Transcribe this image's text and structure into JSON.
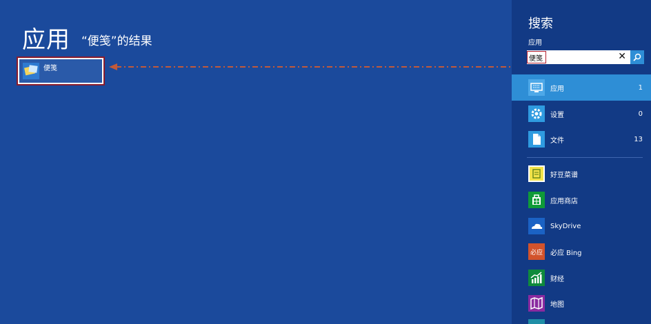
{
  "main": {
    "title": "应用",
    "result_caption": "“便笺”的结果",
    "result": {
      "label": "便笺"
    }
  },
  "search_panel": {
    "title": "搜索",
    "scope_label": "应用",
    "input": {
      "value": "便笺",
      "placeholder": ""
    },
    "clear_icon": "✕",
    "categories": [
      {
        "label": "应用",
        "count": "1",
        "icon": "keyboard-icon"
      },
      {
        "label": "设置",
        "count": "0",
        "icon": "gear-icon"
      },
      {
        "label": "文件",
        "count": "13",
        "icon": "document-icon"
      }
    ],
    "apps": [
      {
        "label": "好豆菜谱",
        "icon": "recipe-icon",
        "color": "#f3e34a"
      },
      {
        "label": "应用商店",
        "icon": "store-icon",
        "color": "#0f9b38"
      },
      {
        "label": "SkyDrive",
        "icon": "cloud-icon",
        "color": "#1b62c4"
      },
      {
        "label": "必应 Bing",
        "icon": "bing-icon",
        "color": "#d2532c",
        "icon_text": "必应"
      },
      {
        "label": "财经",
        "icon": "finance-icon",
        "color": "#0f8a3c"
      },
      {
        "label": "地图",
        "icon": "map-icon",
        "color": "#8a2aa0"
      }
    ]
  },
  "colors": {
    "background": "#1b4a9c",
    "panel": "#123a85",
    "accent": "#2e8ed6",
    "highlight_border": "#b11f2e",
    "arrow": "#c25a3a"
  }
}
